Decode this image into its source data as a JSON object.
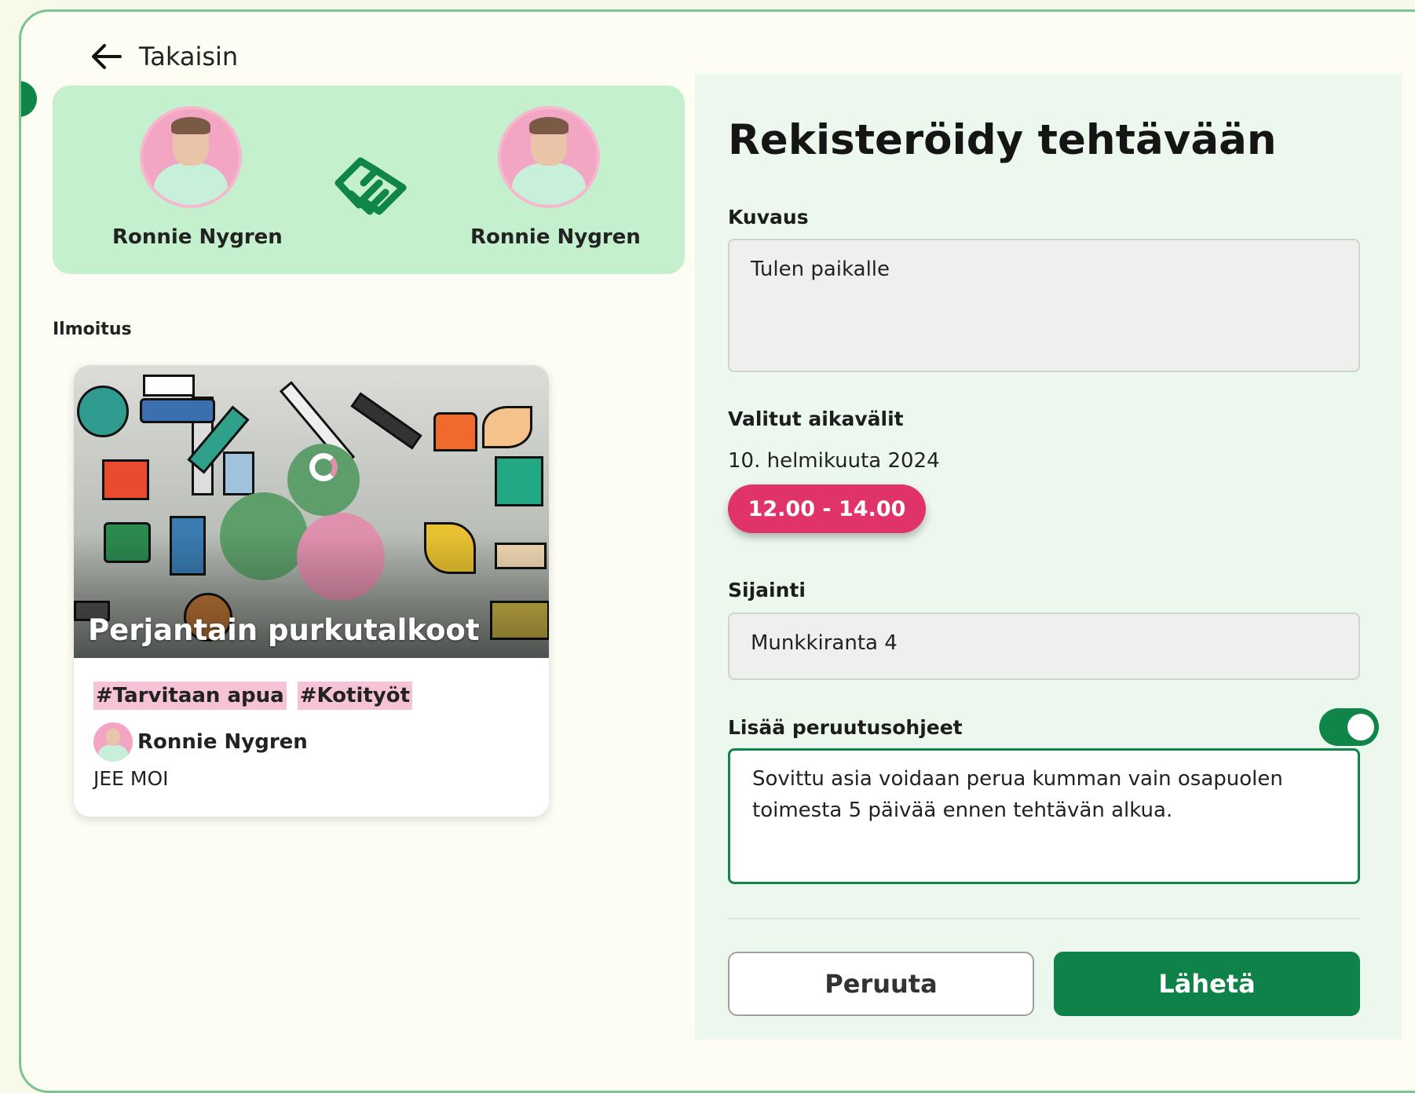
{
  "header": {
    "back_label": "Takaisin"
  },
  "match": {
    "left_person": "Ronnie Nygren",
    "right_person": "Ronnie Nygren"
  },
  "listing": {
    "section_label": "Ilmoitus",
    "title": "Perjantain purkutalkoot",
    "tags": [
      "#Tarvitaan apua",
      "#Kotityöt"
    ],
    "author": "Ronnie Nygren",
    "description": "JEE MOI"
  },
  "form": {
    "title": "Rekisteröidy tehtävään",
    "description_label": "Kuvaus",
    "description_value": "Tulen paikalle",
    "timeslots_label": "Valitut aikavälit",
    "date": "10. helmikuuta 2024",
    "timeslot": "12.00 - 14.00",
    "location_label": "Sijainti",
    "location_value": "Munkkiranta 4",
    "cancellation_label": "Lisää peruutusohjeet",
    "cancellation_enabled": true,
    "cancellation_text": "Sovittu asia voidaan perua kumman vain osapuolen toimesta 5 päivää ennen tehtävän alkua.",
    "cancel_button": "Peruuta",
    "send_button": "Lähetä"
  },
  "colors": {
    "accent_green": "#10854a",
    "match_bg": "#c5f0cd",
    "timeslot_pink": "#e0336a",
    "tag_pink": "#f6c3d6"
  }
}
